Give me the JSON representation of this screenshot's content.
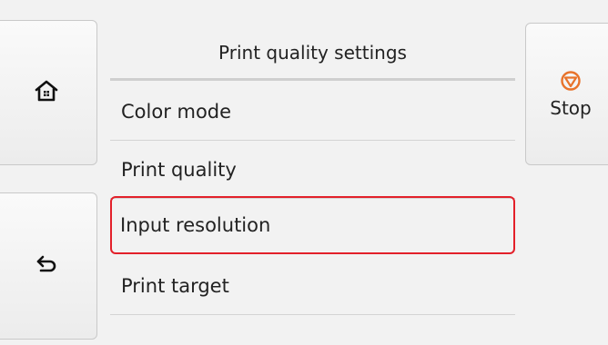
{
  "header": {
    "title": "Print quality settings"
  },
  "menu": {
    "items": [
      {
        "label": "Color mode"
      },
      {
        "label": "Print quality"
      },
      {
        "label": "Input resolution",
        "selected": true
      },
      {
        "label": "Print target"
      }
    ]
  },
  "buttons": {
    "home_icon": "home-icon",
    "back_icon": "back-arrow-icon",
    "stop_icon": "stop-icon",
    "stop_label": "Stop"
  },
  "colors": {
    "selection_border": "#e3202a",
    "stop_icon": "#e8732b"
  }
}
